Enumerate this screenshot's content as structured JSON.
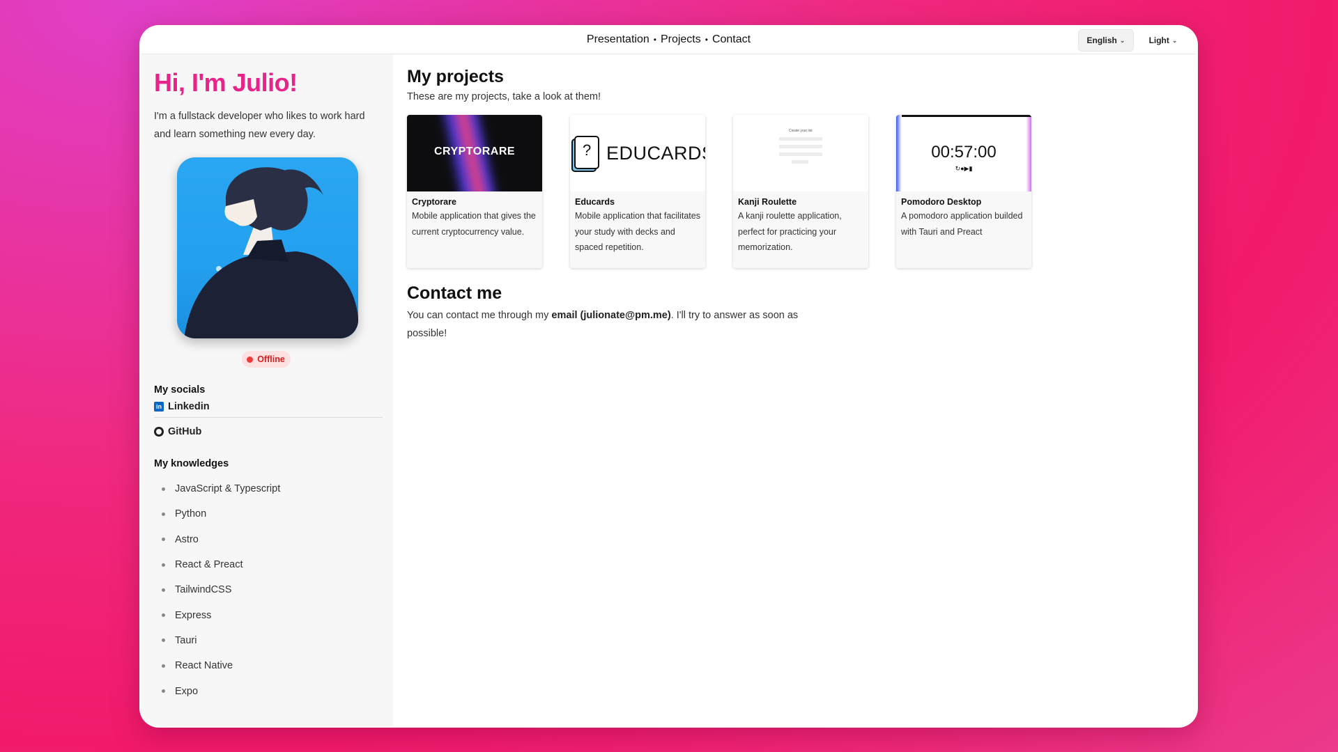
{
  "nav": {
    "items": [
      "Presentation",
      "Projects",
      "Contact"
    ],
    "separator": "•"
  },
  "controls": {
    "language": "English",
    "theme": "Light"
  },
  "sidebar": {
    "title": "Hi, I'm Julio!",
    "intro": "I'm a fullstack developer who likes to work hard and learn something new every day.",
    "status": "Offline",
    "socials_heading": "My socials",
    "socials": [
      "Linkedin",
      "GitHub"
    ],
    "knowledge_heading": "My knowledges",
    "knowledges": [
      "JavaScript & Typescript",
      "Python",
      "Astro",
      "React & Preact",
      "TailwindCSS",
      "Express",
      "Tauri",
      "React Native",
      "Expo"
    ]
  },
  "projects": {
    "heading": "My projects",
    "subtitle": "These are my projects, take a look at them!",
    "items": [
      {
        "title": "Cryptorare",
        "desc": "Mobile application that gives the current cryptocurrency value.",
        "thumb_text": "CRYPTORARE"
      },
      {
        "title": "Educards",
        "desc": "Mobile application that facilitates your study with decks and spaced repetition.",
        "thumb_text": "EDUCARDS"
      },
      {
        "title": "Kanji Roulette",
        "desc": "A kanji roulette application, perfect for practicing your memorization.",
        "thumb_text": "Create your list"
      },
      {
        "title": "Pomodoro Desktop",
        "desc": "A pomodoro application builded with Tauri and Preact",
        "thumb_text": "00:57:00"
      }
    ]
  },
  "contact": {
    "heading": "Contact me",
    "text_before": "You can contact me through my ",
    "email_label": "email (julionate@pm.me)",
    "text_after": ". I'll try to answer as soon as possible!"
  },
  "colors": {
    "accent": "#e8238a",
    "status": "#d61f1f",
    "linkedin": "#0a66c2"
  }
}
